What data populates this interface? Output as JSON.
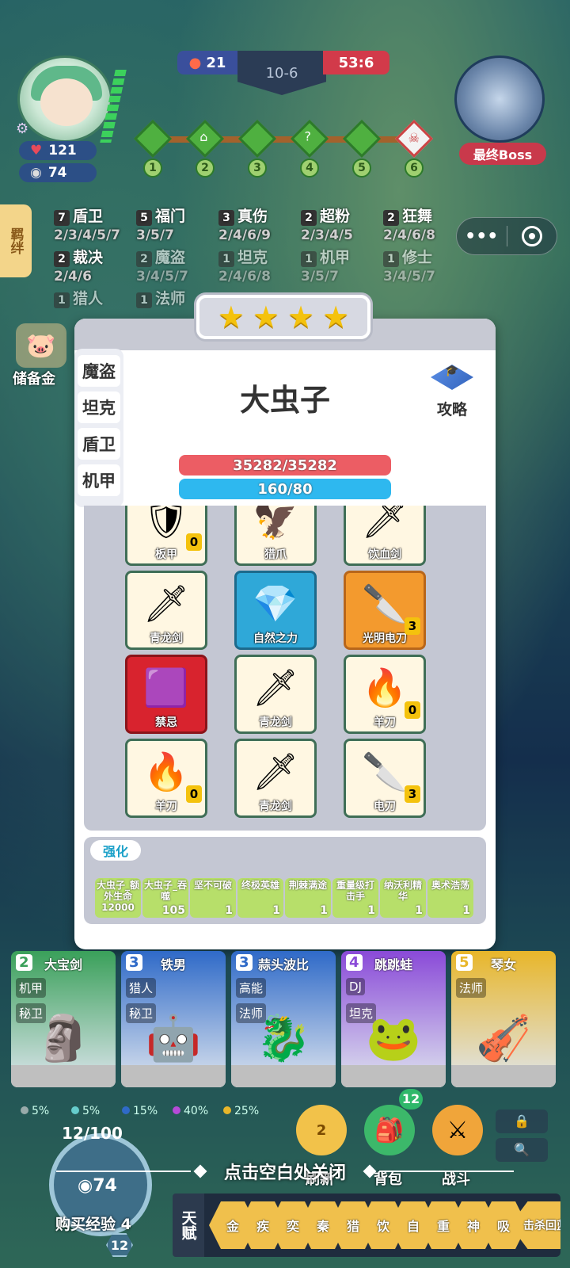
{
  "hud": {
    "hp": "121",
    "gold": "74",
    "score_blue": "21",
    "round": "10-6",
    "score_red": "53:6",
    "stages": [
      "1",
      "2",
      "3",
      "4",
      "5",
      "6"
    ],
    "boss_label": "最终Boss"
  },
  "synergies": [
    {
      "count": "7",
      "name": "盾卫",
      "levels": "2/3/4/5/7"
    },
    {
      "count": "5",
      "name": "福门",
      "levels": "3/5/7"
    },
    {
      "count": "3",
      "name": "真伤",
      "levels": "2/4/6/9"
    },
    {
      "count": "2",
      "name": "超粉",
      "levels": "2/3/4/5"
    },
    {
      "count": "2",
      "name": "狂舞",
      "levels": "2/4/6/8"
    },
    {
      "count": "2",
      "name": "裁决",
      "levels": "2/4/6"
    },
    {
      "count": "2",
      "name": "魔盗",
      "levels": "3/4/5/7"
    },
    {
      "count": "1",
      "name": "坦克",
      "levels": "2/4/6/8"
    },
    {
      "count": "1",
      "name": "机甲",
      "levels": "3/5/7"
    },
    {
      "count": "1",
      "name": "修士",
      "levels": "3/4/5/7"
    },
    {
      "count": "1",
      "name": "猎人",
      "levels": ""
    },
    {
      "count": "1",
      "name": "法师",
      "levels": ""
    }
  ],
  "side": {
    "synergy_tab": "羁绊",
    "piggy_label": "储备金"
  },
  "modal": {
    "star_count": 4,
    "tabs": [
      "魔盗",
      "坦克",
      "盾卫",
      "机甲"
    ],
    "hero_name": "大虫子",
    "guide_label": "攻略",
    "hp_text": "35282/35282",
    "hp_ratio": 1.0,
    "mana_text": "160/80",
    "mana_ratio": 1.0,
    "items": [
      {
        "name": "板甲",
        "icon": "armor-icon",
        "badge": "0",
        "rarity": "normal"
      },
      {
        "name": "猎爪",
        "icon": "claw-icon",
        "badge": "",
        "rarity": "normal"
      },
      {
        "name": "饮血剑",
        "icon": "scythe-icon",
        "badge": "",
        "rarity": "normal"
      },
      {
        "name": "青龙剑",
        "icon": "sword-icon",
        "badge": "",
        "rarity": "normal"
      },
      {
        "name": "自然之力",
        "icon": "crystal-icon",
        "badge": "",
        "rarity": "blue"
      },
      {
        "name": "光明电刀",
        "icon": "blade-icon",
        "badge": "3",
        "rarity": "orange"
      },
      {
        "name": "禁忌",
        "icon": "cube-icon",
        "badge": "",
        "rarity": "red"
      },
      {
        "name": "青龙剑",
        "icon": "sword-icon",
        "badge": "",
        "rarity": "normal"
      },
      {
        "name": "羊刀",
        "icon": "fire-blade-icon",
        "badge": "0",
        "rarity": "normal"
      },
      {
        "name": "羊刀",
        "icon": "fire-blade-icon",
        "badge": "0",
        "rarity": "normal"
      },
      {
        "name": "青龙剑",
        "icon": "sword-icon",
        "badge": "",
        "rarity": "normal"
      },
      {
        "name": "电刀",
        "icon": "blade-icon",
        "badge": "3",
        "rarity": "normal"
      }
    ],
    "enhance_title": "强化",
    "enhancements": [
      {
        "label": "大虫子_额外生命12000",
        "value": ""
      },
      {
        "label": "大虫子_吞噬",
        "value": "105"
      },
      {
        "label": "坚不可破",
        "value": "1"
      },
      {
        "label": "终极英雄",
        "value": "1"
      },
      {
        "label": "荆棘满途",
        "value": "1"
      },
      {
        "label": "重量级打击手",
        "value": "1"
      },
      {
        "label": "纳沃利精华",
        "value": "1"
      },
      {
        "label": "奥术浩荡",
        "value": "1"
      }
    ]
  },
  "shop": [
    {
      "cost": "2",
      "name": "大宝剑",
      "traits": [
        "机甲",
        "秘卫"
      ],
      "color": "#3aa05a"
    },
    {
      "cost": "3",
      "name": "铁男",
      "traits": [
        "猎人",
        "秘卫"
      ],
      "color": "#2f6ac8"
    },
    {
      "cost": "3",
      "name": "蒜头波比",
      "traits": [
        "高能",
        "法师"
      ],
      "color": "#2f6ac8"
    },
    {
      "cost": "4",
      "name": "跳跳蛙",
      "traits": [
        "DJ",
        "坦克"
      ],
      "color": "#8a4ad8"
    },
    {
      "cost": "5",
      "name": "琴女",
      "traits": [
        "法师",
        ""
      ],
      "color": "#e8b62a"
    }
  ],
  "odds": [
    "5%",
    "5%",
    "15%",
    "40%",
    "25%"
  ],
  "odds_colors": [
    "#9aa",
    "#6cc",
    "#2f6ac8",
    "#b64ad8",
    "#e8b62a"
  ],
  "bottom": {
    "xp_progress": "12/100",
    "xp_ratio": 0.12,
    "xp_cost": "74",
    "buy_xp_label": "购买经验 4",
    "level": "12",
    "refresh_cost": "2",
    "refresh_label": "刷新",
    "bag_count": "12",
    "bag_label": "背包",
    "battle_label": "战斗",
    "close_hint": "点击空白处关闭",
    "talent_label": "天赋",
    "talents": [
      "金",
      "疾",
      "奕",
      "秦",
      "猎",
      "饮",
      "自",
      "重",
      "神",
      "吸",
      "击杀回蓝"
    ]
  }
}
